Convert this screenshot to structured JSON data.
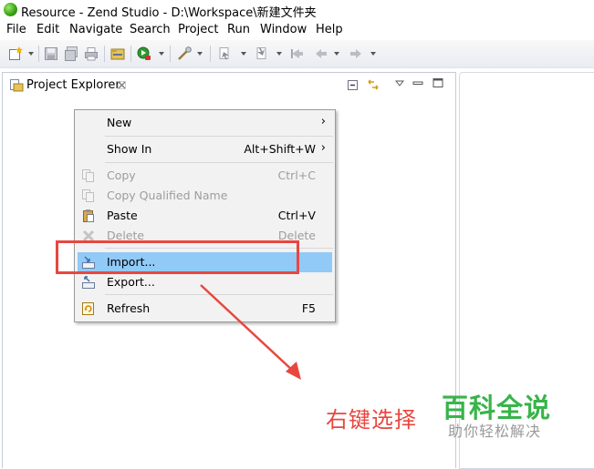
{
  "window": {
    "title": "Resource - Zend Studio - D:\\Workspace\\新建文件夹"
  },
  "menubar": [
    "File",
    "Edit",
    "Navigate",
    "Search",
    "Project",
    "Run",
    "Window",
    "Help"
  ],
  "toolbar_icons": [
    "new-wizard-icon",
    "save-icon",
    "save-all-icon",
    "print-icon",
    "open-type-icon",
    "debug-run-icon",
    "run-tool-icon",
    "next-annotation-icon",
    "prev-annotation-icon",
    "last-edit-icon",
    "back-icon",
    "forward-icon"
  ],
  "explorer": {
    "tab_label": "Project Explorer"
  },
  "context_menu": {
    "items": [
      {
        "label": "New",
        "accelerator": "",
        "submenu": true,
        "enabled": true,
        "icon": ""
      },
      {
        "label": "Show In",
        "accelerator": "Alt+Shift+W",
        "submenu": true,
        "enabled": true,
        "icon": ""
      },
      {
        "label": "Copy",
        "accelerator": "Ctrl+C",
        "submenu": false,
        "enabled": false,
        "icon": "copy-icon"
      },
      {
        "label": "Copy Qualified Name",
        "accelerator": "",
        "submenu": false,
        "enabled": false,
        "icon": "copy-qualified-name-icon"
      },
      {
        "label": "Paste",
        "accelerator": "Ctrl+V",
        "submenu": false,
        "enabled": true,
        "icon": "paste-icon"
      },
      {
        "label": "Delete",
        "accelerator": "Delete",
        "submenu": false,
        "enabled": false,
        "icon": "delete-icon"
      },
      {
        "label": "Import...",
        "accelerator": "",
        "submenu": false,
        "enabled": true,
        "icon": "import-icon",
        "highlighted": true
      },
      {
        "label": "Export...",
        "accelerator": "",
        "submenu": false,
        "enabled": true,
        "icon": "export-icon"
      },
      {
        "label": "Refresh",
        "accelerator": "F5",
        "submenu": false,
        "enabled": true,
        "icon": "refresh-icon"
      }
    ],
    "submenu_glyph": "›"
  },
  "annotation": {
    "text": "右键选择",
    "color": "#e8473f"
  },
  "watermark": {
    "main": "百科全说",
    "sub": "助你轻松解决",
    "main_color": "#38b44a"
  },
  "colors": {
    "menu_highlight": "#91c9f7",
    "menu_background": "#f2f2f2",
    "disabled_text": "#9d9d9d"
  }
}
